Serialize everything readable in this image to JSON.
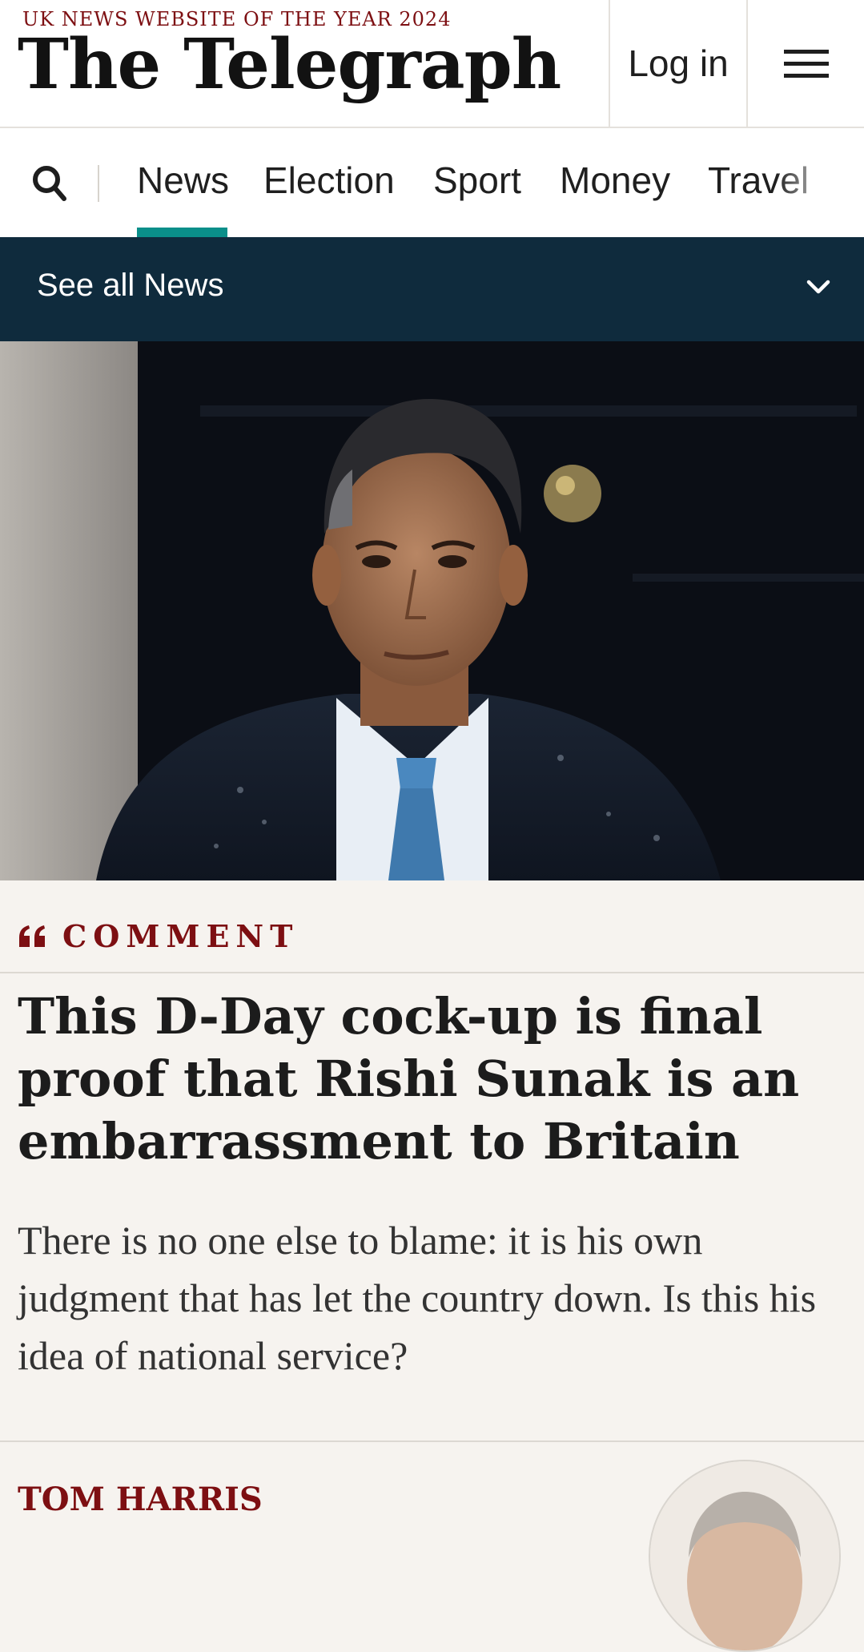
{
  "header": {
    "award": "UK NEWS WEBSITE OF THE YEAR 2024",
    "logo": "The Telegraph",
    "login_label": "Log in",
    "menu_icon": "hamburger-menu-icon"
  },
  "nav": {
    "search_icon": "search-icon",
    "items": [
      {
        "label": "News",
        "active": true
      },
      {
        "label": "Election"
      },
      {
        "label": "Sport"
      },
      {
        "label": "Money"
      },
      {
        "label": "Travel"
      }
    ],
    "accent_color": "#0a8f8a"
  },
  "section_bar": {
    "label": "See all News",
    "icon": "chevron-down-icon",
    "background": "#0f2b3d"
  },
  "article": {
    "kicker": "COMMENT",
    "kicker_icon": "quote-icon",
    "headline": "This D-Day cock-up is final proof that Rishi Sunak is an embarrassment to Britain",
    "standfirst": "There is no one else to blame: it is his own judgment that has let the country down. Is this his idea of national service?",
    "author": "TOM HARRIS",
    "brand_color": "#7d0f12"
  }
}
